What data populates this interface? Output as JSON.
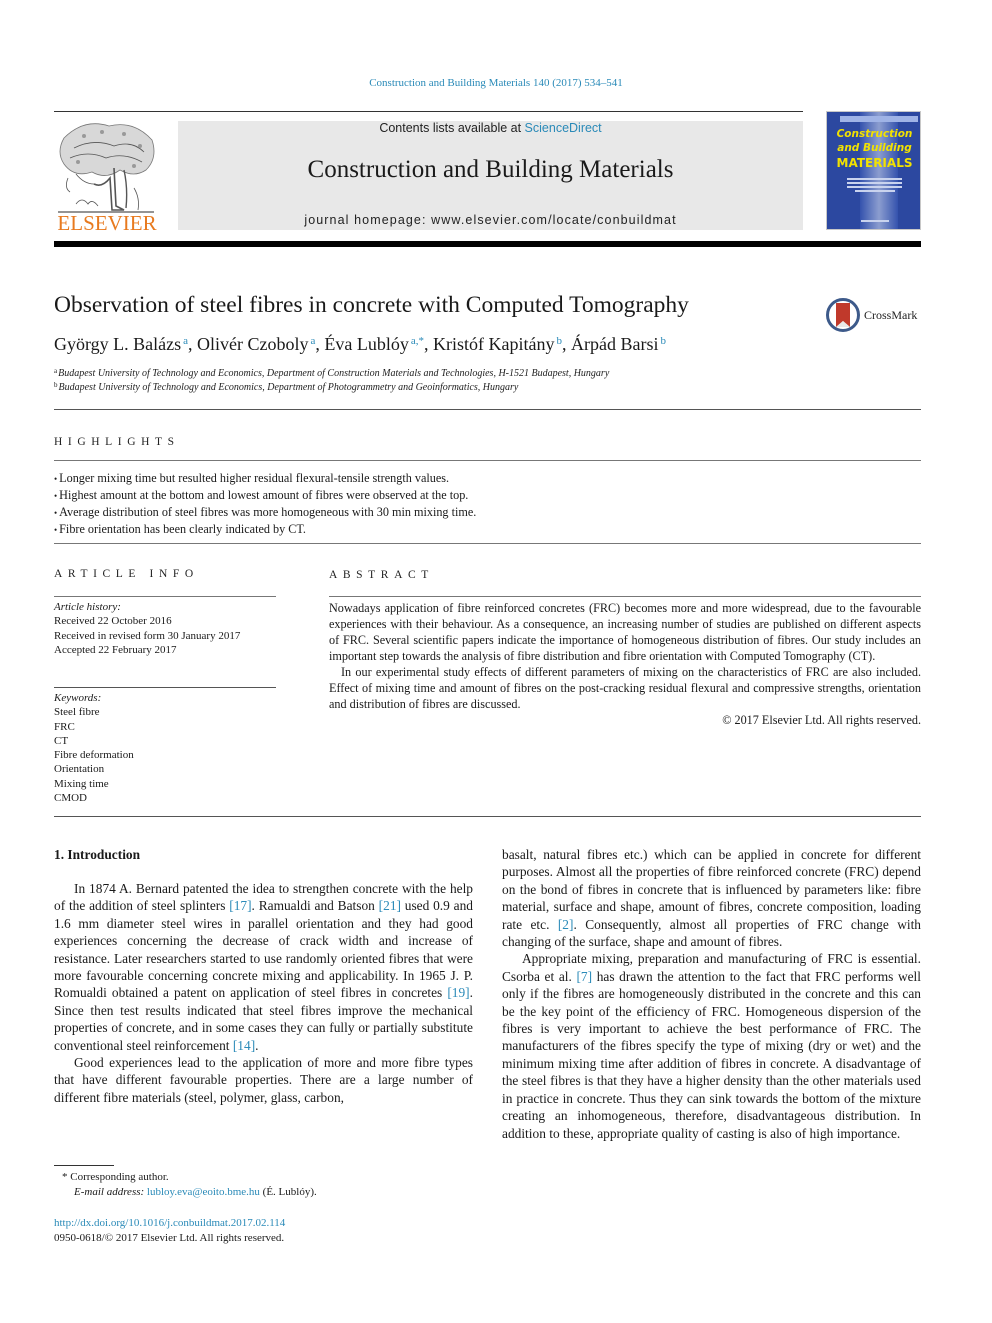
{
  "header": {
    "journal_ref": "Construction and Building Materials 140 (2017) 534–541",
    "contents_prefix": "Contents lists available at ",
    "contents_link": "ScienceDirect",
    "journal_name": "Construction and Building Materials",
    "homepage": "journal homepage: www.elsevier.com/locate/conbuildmat",
    "publisher_logo_text": "ELSEVIER",
    "cover": {
      "line1": "Construction",
      "line2": "and Building",
      "line3": "MATERIALS",
      "bg_color": "#2c48a0",
      "text_color": "#f2e200"
    },
    "brand_colors": {
      "link": "#2a8ab8",
      "elsevier_orange": "#e87a1f"
    }
  },
  "article": {
    "title": "Observation of steel fibres in concrete with Computed Tomography",
    "crossmark_label": "CrossMark",
    "authors": [
      {
        "name": "György L. Balázs",
        "sup": "a",
        "sep": ", "
      },
      {
        "name": "Olivér Czoboly",
        "sup": "a",
        "sep": ", "
      },
      {
        "name": "Éva Lublóy",
        "sup": "a,*",
        "sep": ", "
      },
      {
        "name": "Kristóf Kapitány",
        "sup": "b",
        "sep": ", "
      },
      {
        "name": "Árpád Barsi",
        "sup": "b",
        "sep": ""
      }
    ],
    "affiliations": [
      {
        "mark": "a",
        "text": "Budapest University of Technology and Economics, Department of Construction Materials and Technologies, H-1521 Budapest, Hungary"
      },
      {
        "mark": "b",
        "text": "Budapest University of Technology and Economics, Department of Photogrammetry and Geoinformatics, Hungary"
      }
    ]
  },
  "highlights": {
    "heading": "HIGHLIGHTS",
    "items": [
      "Longer mixing time but resulted higher residual flexural-tensile strength values.",
      "Highest amount at the bottom and lowest amount of fibres were observed at the top.",
      "Average distribution of steel fibres was more homogeneous with 30 min mixing time.",
      "Fibre orientation has been clearly indicated by CT."
    ]
  },
  "article_info": {
    "heading": "ARTICLE INFO",
    "history_label": "Article history:",
    "history": [
      "Received 22 October 2016",
      "Received in revised form 30 January 2017",
      "Accepted 22 February 2017"
    ],
    "keywords_label": "Keywords:",
    "keywords": [
      "Steel fibre",
      "FRC",
      "CT",
      "Fibre deformation",
      "Orientation",
      "Mixing time",
      "CMOD"
    ]
  },
  "abstract": {
    "heading": "ABSTRACT",
    "paragraphs": [
      "Nowadays application of fibre reinforced concretes (FRC) becomes more and more widespread, due to the favourable experiences with their behaviour. As a consequence, an increasing number of studies are published on different aspects of FRC. Several scientific papers indicate the importance of homogeneous distribution of fibres. Our study includes an important step towards the analysis of fibre distribution and fibre orientation with Computed Tomography (CT).",
      "In our experimental study effects of different parameters of mixing on the characteristics of FRC are also included. Effect of mixing time and amount of fibres on the post-cracking residual flexural and compressive strengths, orientation and distribution of fibres are discussed."
    ],
    "copyright": "© 2017 Elsevier Ltd. All rights reserved."
  },
  "body": {
    "section_heading": "1. Introduction",
    "left": {
      "p1": [
        {
          "t": "In 1874 A. Bernard patented the idea to strengthen concrete with the help of the addition of steel splinters "
        },
        {
          "ref": "[17]"
        },
        {
          "t": ". Ramualdi and Batson "
        },
        {
          "ref": "[21]"
        },
        {
          "t": " used 0.9 and 1.6 mm diameter steel wires in parallel orientation and they had good experiences concerning the decrease of crack width and increase of resistance. Later researchers started to use randomly oriented fibres that were more favourable concerning concrete mixing and applicability. In 1965 J. P. Romualdi obtained a patent on application of steel fibres in concretes "
        },
        {
          "ref": "[19]"
        },
        {
          "t": ". Since then test results indicated that steel fibres improve the mechanical properties of concrete, and in some cases they can fully or partially substitute conventional steel reinforcement "
        },
        {
          "ref": "[14]"
        },
        {
          "t": "."
        }
      ],
      "p2": "Good experiences lead to the application of more and more fibre types that have different favourable properties. There are a large number of different fibre materials (steel, polymer, glass, carbon,"
    },
    "right": {
      "p1": [
        {
          "t": "basalt, natural fibres etc.) which can be applied in concrete for different purposes. Almost all the properties of fibre reinforced concrete (FRC) depend on the bond of fibres in concrete that is influenced by parameters like: fibre material, surface and shape, amount of fibres, concrete composition, loading rate etc. "
        },
        {
          "ref": "[2]"
        },
        {
          "t": ". Consequently, almost all properties of FRC change with changing of the surface, shape and amount of fibres."
        }
      ],
      "p2": [
        {
          "t": "Appropriate mixing, preparation and manufacturing of FRC is essential. Csorba et al. "
        },
        {
          "ref": "[7]"
        },
        {
          "t": " has drawn the attention to the fact that FRC performs well only if the fibres are homogeneously distributed in the concrete and this can be the key point of the efficiency of FRC. Homogeneous dispersion of the fibres is very important to achieve the best performance of FRC. The manufacturers of the fibres specify the type of mixing (dry or wet) and the minimum mixing time after addition of fibres in concrete. A disadvantage of the steel fibres is that they have a higher density than the other materials used in practice in concrete. Thus they can sink towards the bottom of the mixture creating an inhomogeneous, therefore, disadvantageous distribution. In addition to these, appropriate quality of casting is also of high importance."
        }
      ]
    }
  },
  "footnote": {
    "star_text": "* Corresponding author.",
    "email_label": "E-mail address:",
    "email": "lubloy.eva@eoito.bme.hu",
    "email_owner": "(É. Lublóy)."
  },
  "footer": {
    "doi": "http://dx.doi.org/10.1016/j.conbuildmat.2017.02.114",
    "issn_line": "0950-0618/© 2017 Elsevier Ltd. All rights reserved."
  }
}
